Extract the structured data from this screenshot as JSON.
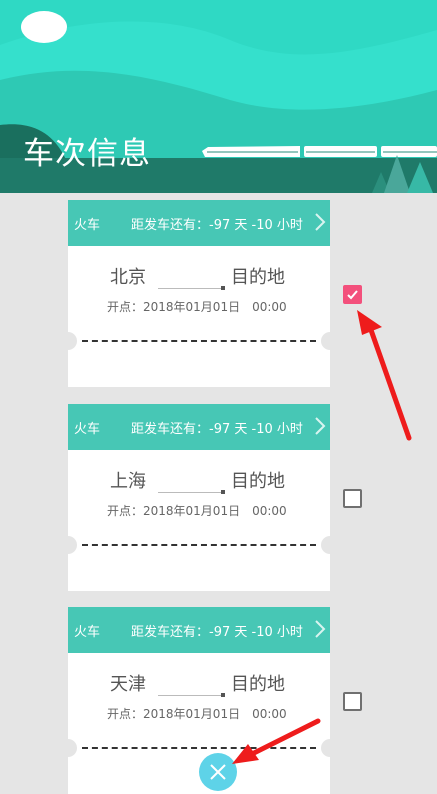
{
  "header": {
    "title": "车次信息"
  },
  "tickets": [
    {
      "type": "火车",
      "countdown": "距发车还有：-97 天 -10 小时",
      "from": "北京",
      "to": "目的地",
      "depart": "开点：2018年01月01日　00:00",
      "checked": true
    },
    {
      "type": "火车",
      "countdown": "距发车还有：-97 天 -10 小时",
      "from": "上海",
      "to": "目的地",
      "depart": "开点：2018年01月01日　00:00",
      "checked": false
    },
    {
      "type": "火车",
      "countdown": "距发车还有：-97 天 -10 小时",
      "from": "天津",
      "to": "目的地",
      "depart": "开点：2018年01月01日　00:00",
      "checked": false
    }
  ],
  "icons": {
    "chevron": "chevron-right-icon",
    "checkbox": "checkbox-icon",
    "fab": "close-icon"
  },
  "colors": {
    "header_teal": "#2fd9c4",
    "ticket_head": "#47c7b5",
    "checked": "#f3507c",
    "fab": "#5ed3e8",
    "arrow": "#ee1c1c"
  }
}
